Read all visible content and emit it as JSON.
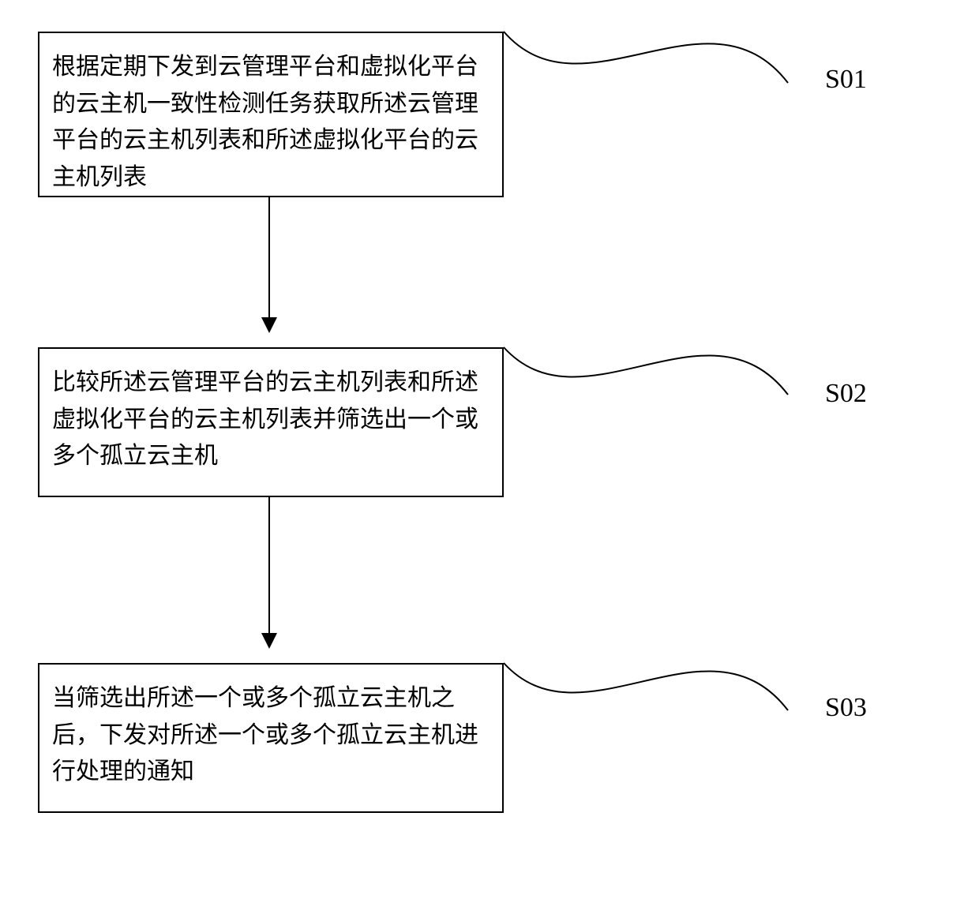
{
  "flowchart": {
    "steps": [
      {
        "id": "S01",
        "text": "根据定期下发到云管理平台和虚拟化平台的云主机一致性检测任务获取所述云管理平台的云主机列表和所述虚拟化平台的云主机列表",
        "label": "S01"
      },
      {
        "id": "S02",
        "text": "比较所述云管理平台的云主机列表和所述虚拟化平台的云主机列表并筛选出一个或多个孤立云主机",
        "label": "S02"
      },
      {
        "id": "S03",
        "text": "当筛选出所述一个或多个孤立云主机之后，下发对所述一个或多个孤立云主机进行处理的通知",
        "label": "S03"
      }
    ]
  },
  "chart_data": {
    "type": "flowchart",
    "direction": "vertical",
    "nodes": [
      {
        "id": "S01",
        "label": "S01",
        "text": "根据定期下发到云管理平台和虚拟化平台的云主机一致性检测任务获取所述云管理平台的云主机列表和所述虚拟化平台的云主机列表"
      },
      {
        "id": "S02",
        "label": "S02",
        "text": "比较所述云管理平台的云主机列表和所述虚拟化平台的云主机列表并筛选出一个或多个孤立云主机"
      },
      {
        "id": "S03",
        "label": "S03",
        "text": "当筛选出所述一个或多个孤立云主机之后，下发对所述一个或多个孤立云主机进行处理的通知"
      }
    ],
    "edges": [
      {
        "from": "S01",
        "to": "S02"
      },
      {
        "from": "S02",
        "to": "S03"
      }
    ]
  }
}
